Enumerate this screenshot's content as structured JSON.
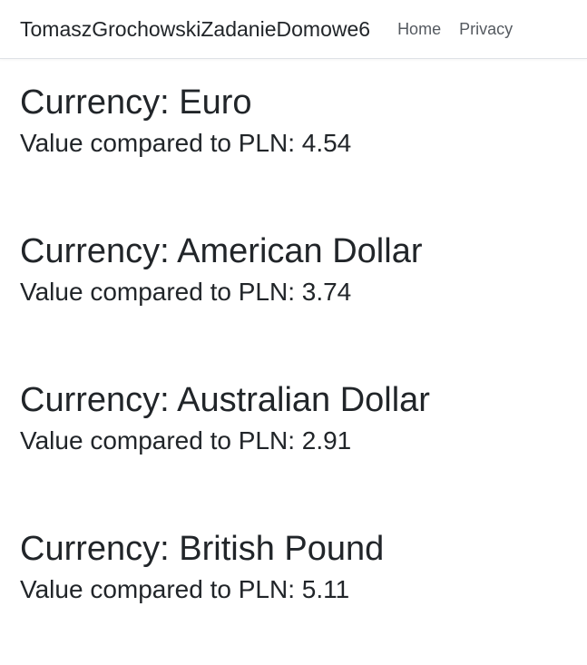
{
  "navbar": {
    "brand": "TomaszGrochowskiZadanieDomowe6",
    "links": [
      "Home",
      "Privacy"
    ]
  },
  "currencies": [
    {
      "title": "Currency: Euro",
      "value_text": "Value compared to PLN: 4.54"
    },
    {
      "title": "Currency: American Dollar",
      "value_text": "Value compared to PLN: 3.74"
    },
    {
      "title": "Currency: Australian Dollar",
      "value_text": "Value compared to PLN: 2.91"
    },
    {
      "title": "Currency: British Pound",
      "value_text": "Value compared to PLN: 5.11"
    }
  ]
}
